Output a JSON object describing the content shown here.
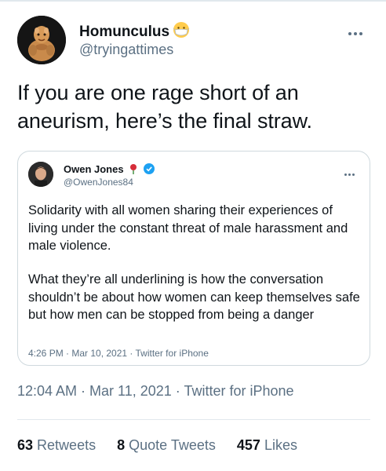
{
  "author": {
    "display_name": "Homunculus",
    "handle": "@tryingattimes",
    "avatar_icon": "homunculus-avatar",
    "badge_icon": "face-with-medical-mask-emoji"
  },
  "tweet": {
    "text": "If you are one rage short of an aneurism, here’s the final straw.",
    "timestamp": "12:04 AM · Mar 11, 2021 · Twitter for iPhone"
  },
  "quoted_tweet": {
    "display_name": "Owen Jones",
    "handle": "@OwenJones84",
    "badges": [
      "rose-icon",
      "verified-icon"
    ],
    "accent_color": "#1da1f2",
    "paragraph_1": "Solidarity with all women sharing their experiences of living under the constant threat of male harassment and male violence.",
    "paragraph_2": "What they’re all underlining is how the conversation shouldn’t be about how women can keep themselves safe but how men can be stopped from being a danger",
    "timestamp": "4:26 PM · Mar 10, 2021 · Twitter for iPhone"
  },
  "stats": {
    "retweets_count": "63",
    "retweets_label": "Retweets",
    "quotes_count": "8",
    "quotes_label": "Quote Tweets",
    "likes_count": "457",
    "likes_label": "Likes"
  }
}
